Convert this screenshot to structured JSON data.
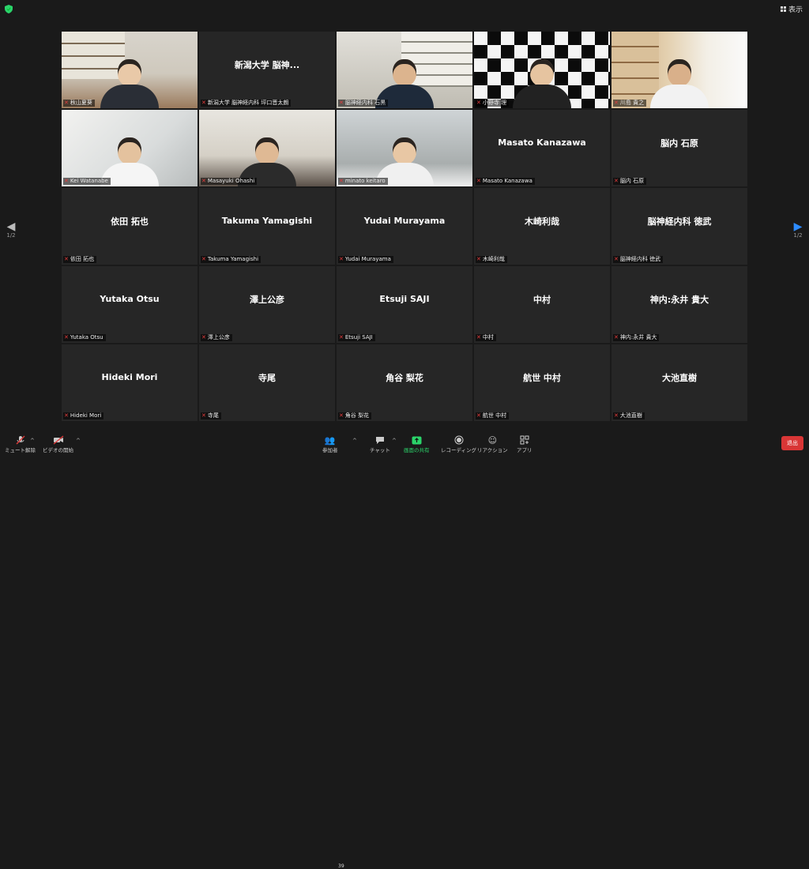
{
  "header": {
    "view_label": "表示"
  },
  "pager": {
    "left": "1/2",
    "right": "1/2"
  },
  "tiles": [
    {
      "center": "",
      "label": "秋山夏葵",
      "scene": "office"
    },
    {
      "center": "新潟大学 脳神...",
      "label": "新潟大学 脳神経内科 坪口晋太朗",
      "scene": ""
    },
    {
      "center": "",
      "label": "脳神経内科 石黒",
      "scene": "office2"
    },
    {
      "center": "",
      "label": "小野寺 理",
      "scene": "checker"
    },
    {
      "center": "",
      "label": "川島 貴之",
      "scene": "books"
    },
    {
      "center": "",
      "label": "Kei Watanabe",
      "scene": "bright"
    },
    {
      "center": "",
      "label": "Masayuki Ohashi",
      "scene": "room",
      "active": true
    },
    {
      "center": "",
      "label": "minato keitaro",
      "scene": "lab"
    },
    {
      "center": "Masato Kanazawa",
      "label": "Masato Kanazawa",
      "scene": ""
    },
    {
      "center": "脳内 石原",
      "label": "脳内 石原",
      "scene": ""
    },
    {
      "center": "依田 拓也",
      "label": "依田 拓也",
      "scene": ""
    },
    {
      "center": "Takuma Yamagishi",
      "label": "Takuma Yamagishi",
      "scene": ""
    },
    {
      "center": "Yudai Murayama",
      "label": "Yudai Murayama",
      "scene": ""
    },
    {
      "center": "木崎利哉",
      "label": "木崎利哉",
      "scene": ""
    },
    {
      "center": "脳神経内科 徳武",
      "label": "脳神経内科 徳武",
      "scene": ""
    },
    {
      "center": "Yutaka Otsu",
      "label": "Yutaka Otsu",
      "scene": ""
    },
    {
      "center": "澤上公彦",
      "label": "澤上公彦",
      "scene": ""
    },
    {
      "center": "Etsuji SAJI",
      "label": "Etsuji SAJI",
      "scene": ""
    },
    {
      "center": "中村",
      "label": "中村",
      "scene": ""
    },
    {
      "center": "神内:永井 貴大",
      "label": "神内:永井 貴大",
      "scene": ""
    },
    {
      "center": "Hideki Mori",
      "label": "Hideki Mori",
      "scene": ""
    },
    {
      "center": "寺尾",
      "label": "寺尾",
      "scene": ""
    },
    {
      "center": "角谷 梨花",
      "label": "角谷 梨花",
      "scene": ""
    },
    {
      "center": "航世 中村",
      "label": "航世 中村",
      "scene": ""
    },
    {
      "center": "大池直樹",
      "label": "大池直樹",
      "scene": ""
    }
  ],
  "toolbar": {
    "mute": "ミュート解除",
    "video": "ビデオの開始",
    "participants": "参加者",
    "participants_count": "39",
    "chat": "チャット",
    "share": "画面の共有",
    "record": "レコーディング",
    "reactions": "リアクション",
    "apps": "アプリ",
    "leave": "退出"
  },
  "colors": {
    "accent": "#2d8cff",
    "share": "#2bd46a",
    "leave": "#d93636",
    "active_border": "#d6d447",
    "mic_off": "#e23b3b"
  }
}
